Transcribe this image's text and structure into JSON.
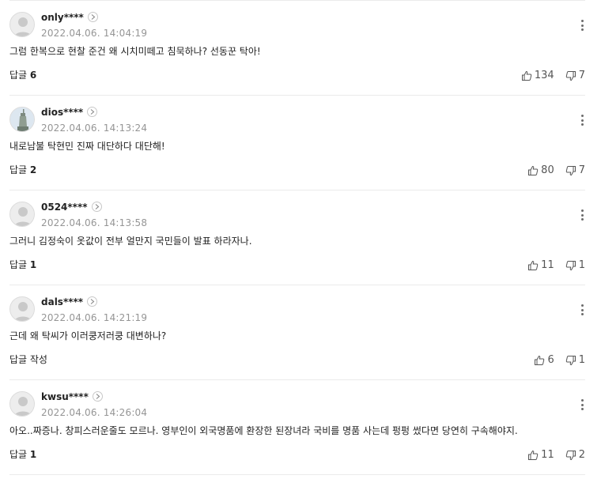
{
  "comments": [
    {
      "nick": "only****",
      "time": "2022.04.06. 14:04:19",
      "text": "그럼 한복으로 현찰 준건 왜 시치미떼고 침묵하나? 선동꾼 탁아!",
      "reply_label": "답글",
      "reply_count": "6",
      "likes": "134",
      "dislikes": "7",
      "avatar": "default"
    },
    {
      "nick": "dios****",
      "time": "2022.04.06. 14:13:24",
      "text": "내로남불 탁현민 진짜 대단하다 대단해!",
      "reply_label": "답글",
      "reply_count": "2",
      "likes": "80",
      "dislikes": "7",
      "avatar": "statue"
    },
    {
      "nick": "0524****",
      "time": "2022.04.06. 14:13:58",
      "text": "그러니 김정숙이 옷값이 전부 얼만지 국민들이 발표 하라자나.",
      "reply_label": "답글",
      "reply_count": "1",
      "likes": "11",
      "dislikes": "1",
      "avatar": "default"
    },
    {
      "nick": "dals****",
      "time": "2022.04.06. 14:21:19",
      "text": "근데 왜 탁씨가 이러쿵저러쿵 대변하나?",
      "reply_label": "답글 작성",
      "reply_count": "",
      "likes": "6",
      "dislikes": "1",
      "avatar": "default"
    },
    {
      "nick": "kwsu****",
      "time": "2022.04.06. 14:26:04",
      "text": "아오..짜증나. 창피스러운줄도 모르나. 영부인이 외국명품에 환장한 된장녀라 국비를 명품 사는데 펑펑 썼다면 당연히 구속해야지.",
      "reply_label": "답글",
      "reply_count": "1",
      "likes": "11",
      "dislikes": "2",
      "avatar": "default"
    }
  ],
  "icons": {
    "like": "thumbs-up-icon",
    "dislike": "thumbs-down-icon",
    "more": "kebab-menu-icon",
    "profile": "chevron-right-icon"
  }
}
